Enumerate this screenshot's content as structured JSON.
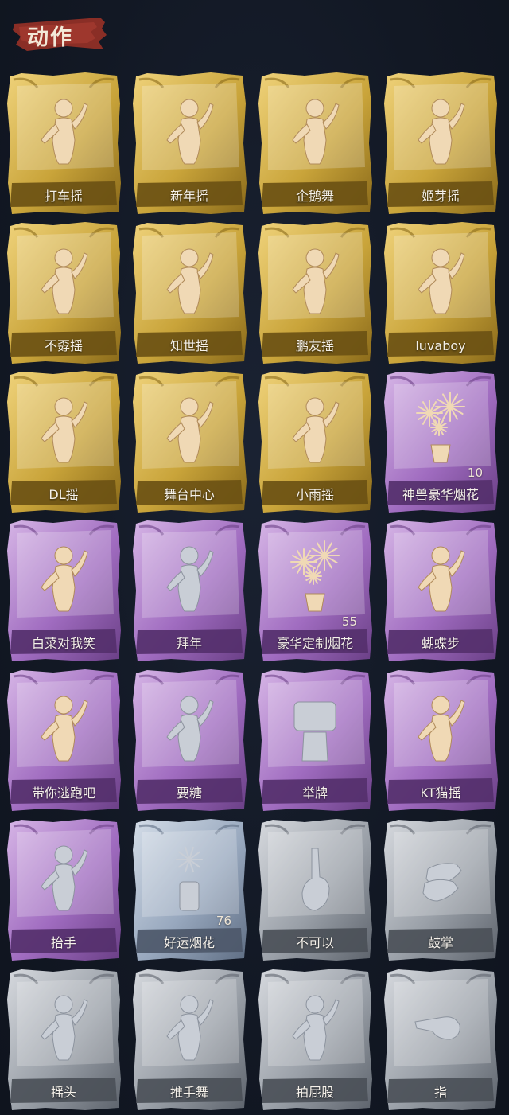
{
  "section": {
    "title": "动作"
  },
  "rarity_colors": {
    "gold": {
      "base": "#c9a43a",
      "light": "#efd27a",
      "dark": "#8a6a1a",
      "band": "#6b5114"
    },
    "purple": {
      "base": "#a06cc0",
      "light": "#d6b5e6",
      "dark": "#6a3f86",
      "band": "#55306d"
    },
    "blue": {
      "base": "#98a8be",
      "light": "#d4dde8",
      "dark": "#5f6e84",
      "band": "#4d586a"
    },
    "gray": {
      "base": "#9aa0a8",
      "light": "#d6d9de",
      "dark": "#5d636c",
      "band": "#4b5058"
    }
  },
  "actions": [
    {
      "label": "打车摇",
      "rarity": "gold",
      "icon": "dance-figure-icon",
      "owned": true
    },
    {
      "label": "新年摇",
      "rarity": "gold",
      "icon": "dance-figure-icon",
      "owned": true
    },
    {
      "label": "企鹅舞",
      "rarity": "gold",
      "icon": "dance-figure-icon",
      "owned": true
    },
    {
      "label": "姬芽摇",
      "rarity": "gold",
      "icon": "dance-figure-icon",
      "owned": true
    },
    {
      "label": "不孬摇",
      "rarity": "gold",
      "icon": "dance-figure-icon",
      "owned": true
    },
    {
      "label": "知世摇",
      "rarity": "gold",
      "icon": "dance-figure-icon",
      "owned": true
    },
    {
      "label": "鹏友摇",
      "rarity": "gold",
      "icon": "dance-figure-icon",
      "owned": true
    },
    {
      "label": "luvaboy",
      "rarity": "gold",
      "icon": "dance-figure-icon",
      "owned": true
    },
    {
      "label": "DL摇",
      "rarity": "gold",
      "icon": "dance-figure-icon",
      "owned": true
    },
    {
      "label": "舞台中心",
      "rarity": "gold",
      "icon": "dance-figure-icon",
      "owned": true
    },
    {
      "label": "小雨摇",
      "rarity": "gold",
      "icon": "dance-figure-icon",
      "owned": true
    },
    {
      "label": "神兽豪华烟花",
      "rarity": "purple",
      "icon": "fireworks-icon",
      "owned": true,
      "count": "10"
    },
    {
      "label": "白菜对我笑",
      "rarity": "purple",
      "icon": "dance-figure-icon",
      "owned": true
    },
    {
      "label": "拜年",
      "rarity": "purple",
      "icon": "dance-figure-icon",
      "owned": false
    },
    {
      "label": "豪华定制烟花",
      "rarity": "purple",
      "icon": "fireworks-icon",
      "owned": true,
      "count": "55"
    },
    {
      "label": "蝴蝶步",
      "rarity": "purple",
      "icon": "dance-figure-icon",
      "owned": true
    },
    {
      "label": "带你逃跑吧",
      "rarity": "purple",
      "icon": "dance-figure-icon",
      "owned": true
    },
    {
      "label": "要糖",
      "rarity": "purple",
      "icon": "dance-figure-icon",
      "owned": false
    },
    {
      "label": "举牌",
      "rarity": "purple",
      "icon": "sign-holding-icon",
      "owned": false
    },
    {
      "label": "KT猫摇",
      "rarity": "purple",
      "icon": "dance-figure-icon",
      "owned": true
    },
    {
      "label": "抬手",
      "rarity": "purple",
      "icon": "dance-figure-icon",
      "owned": false
    },
    {
      "label": "好运烟花",
      "rarity": "blue",
      "icon": "firework-can-icon",
      "owned": false,
      "count": "76"
    },
    {
      "label": "不可以",
      "rarity": "gray",
      "icon": "finger-wag-icon",
      "owned": false
    },
    {
      "label": "鼓掌",
      "rarity": "gray",
      "icon": "clap-hands-icon",
      "owned": false
    },
    {
      "label": "摇头",
      "rarity": "gray",
      "icon": "dance-figure-icon",
      "owned": false
    },
    {
      "label": "推手舞",
      "rarity": "gray",
      "icon": "dance-figure-icon",
      "owned": false
    },
    {
      "label": "拍屁股",
      "rarity": "gray",
      "icon": "dance-figure-icon",
      "owned": false
    },
    {
      "label": "指",
      "rarity": "gray",
      "icon": "pointing-hand-icon",
      "owned": false
    }
  ]
}
